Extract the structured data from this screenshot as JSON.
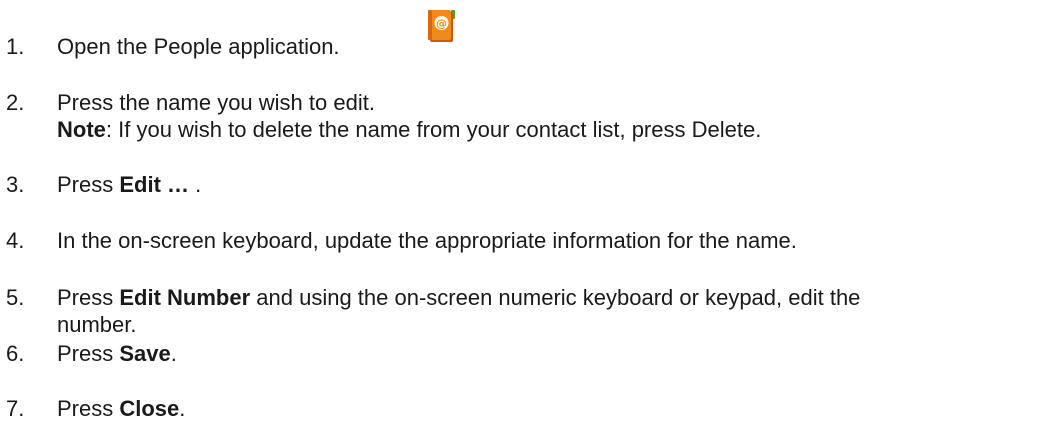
{
  "steps": [
    {
      "number": "1.",
      "text": "Open the People application.",
      "icon": "address-book-icon"
    },
    {
      "number": "2.",
      "text": "Press the name you wish to edit.",
      "note_label": "Note",
      "note_text": ": If you wish to delete the name from your contact list, press Delete."
    },
    {
      "number": "3.",
      "pre": "Press ",
      "bold": "Edit …",
      "post": " ."
    },
    {
      "number": "4.",
      "text": "In the on-screen keyboard, update the appropriate information for the name."
    },
    {
      "number": "5.",
      "pre": "Press ",
      "bold": "Edit Number",
      "post": " and using the on-screen numeric keyboard or keypad, edit the",
      "post_line2": "number."
    },
    {
      "number": "6.",
      "pre": "Press ",
      "bold": "Save",
      "post": "."
    },
    {
      "number": "7.",
      "pre": "Press ",
      "bold": "Close",
      "post": "."
    }
  ],
  "colors": {
    "text": "#1a1a1a",
    "icon_orange": "#f08a1c",
    "icon_dark": "#c85a0a",
    "icon_tab": "#5a9e2a"
  }
}
